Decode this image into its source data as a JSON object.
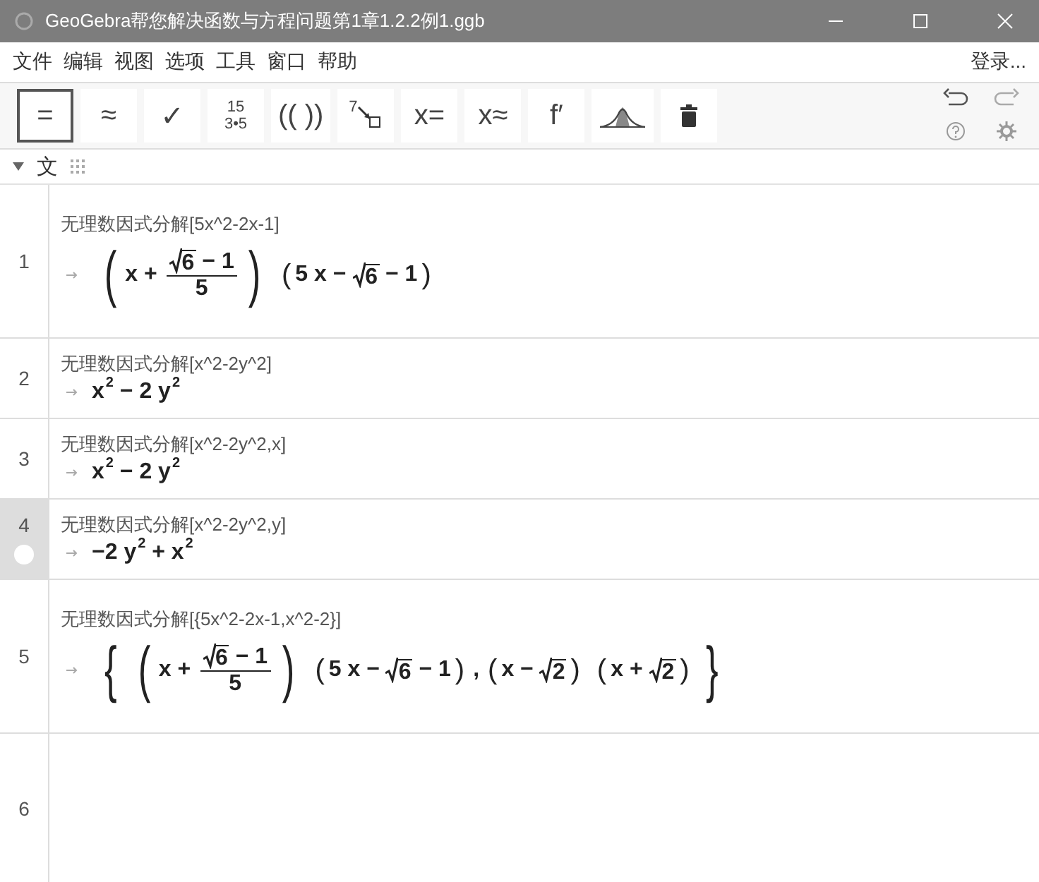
{
  "window": {
    "title": "GeoGebra帮您解决函数与方程问题第1章1.2.2例1.ggb"
  },
  "menu": [
    "文件",
    "编辑",
    "视图",
    "选项",
    "工具",
    "窗口",
    "帮助"
  ],
  "login": "登录...",
  "tools": [
    {
      "kind": "text",
      "label": "=",
      "selected": true
    },
    {
      "kind": "text",
      "label": "≈",
      "selected": false
    },
    {
      "kind": "text",
      "label": "✓",
      "selected": false
    },
    {
      "kind": "frac",
      "num": "15",
      "den": "3•5",
      "selected": false
    },
    {
      "kind": "text",
      "label": "(( ))",
      "selected": false
    },
    {
      "kind": "round",
      "label": "7",
      "selected": false
    },
    {
      "kind": "text",
      "label": "x=",
      "selected": false
    },
    {
      "kind": "text",
      "label": "x≈",
      "selected": false
    },
    {
      "kind": "text",
      "label": "f′",
      "selected": false
    },
    {
      "kind": "curve",
      "selected": false
    },
    {
      "kind": "trash",
      "selected": false
    }
  ],
  "algebra_header": {
    "expanded": true,
    "label": "文"
  },
  "rows": [
    {
      "number": "1",
      "input": "无理数因式分解[5x^2-2x-1]",
      "selected": false,
      "output": [
        {
          "kind": "group",
          "open": "(",
          "close": ")",
          "items": [
            {
              "kind": "t",
              "text": "x + "
            },
            {
              "kind": "frac",
              "num": [
                {
                  "kind": "sqrt",
                  "text": "6"
                },
                {
                  "kind": "t",
                  "text": " − 1"
                }
              ],
              "den": [
                {
                  "kind": "t",
                  "text": "5"
                }
              ]
            }
          ]
        },
        {
          "kind": "group",
          "open": "(",
          "close": ")",
          "items": [
            {
              "kind": "t",
              "text": "5 x − "
            },
            {
              "kind": "sqrt",
              "text": "6"
            },
            {
              "kind": "t",
              "text": " − 1"
            }
          ]
        }
      ]
    },
    {
      "number": "2",
      "input": "无理数因式分解[x^2-2y^2]",
      "selected": false,
      "output": [
        {
          "kind": "t",
          "text": "x"
        },
        {
          "kind": "sup",
          "text": "2"
        },
        {
          "kind": "t",
          "text": " − 2 y"
        },
        {
          "kind": "sup",
          "text": "2"
        }
      ]
    },
    {
      "number": "3",
      "input": "无理数因式分解[x^2-2y^2,x]",
      "selected": false,
      "output": [
        {
          "kind": "t",
          "text": "x"
        },
        {
          "kind": "sup",
          "text": "2"
        },
        {
          "kind": "t",
          "text": " − 2 y"
        },
        {
          "kind": "sup",
          "text": "2"
        }
      ]
    },
    {
      "number": "4",
      "input": "无理数因式分解[x^2-2y^2,y]",
      "selected": true,
      "output": [
        {
          "kind": "t",
          "text": "−2 y"
        },
        {
          "kind": "sup",
          "text": "2"
        },
        {
          "kind": "t",
          "text": " + x"
        },
        {
          "kind": "sup",
          "text": "2"
        }
      ]
    },
    {
      "number": "5",
      "input": "无理数因式分解[{5x^2-2x-1,x^2-2}]",
      "selected": false,
      "output": [
        {
          "kind": "group",
          "open": "{",
          "close": "}",
          "items": [
            {
              "kind": "group",
              "open": "(",
              "close": ")",
              "items": [
                {
                  "kind": "t",
                  "text": "x + "
                },
                {
                  "kind": "frac",
                  "num": [
                    {
                      "kind": "sqrt",
                      "text": "6"
                    },
                    {
                      "kind": "t",
                      "text": " − 1"
                    }
                  ],
                  "den": [
                    {
                      "kind": "t",
                      "text": "5"
                    }
                  ]
                }
              ]
            },
            {
              "kind": "group",
              "open": "(",
              "close": ")",
              "items": [
                {
                  "kind": "t",
                  "text": "5 x − "
                },
                {
                  "kind": "sqrt",
                  "text": "6"
                },
                {
                  "kind": "t",
                  "text": " − 1"
                }
              ]
            },
            {
              "kind": "t",
              "text": ","
            },
            {
              "kind": "group",
              "open": "(",
              "close": ")",
              "items": [
                {
                  "kind": "t",
                  "text": "x − "
                },
                {
                  "kind": "sqrt",
                  "text": "2"
                }
              ]
            },
            {
              "kind": "group",
              "open": "(",
              "close": ")",
              "items": [
                {
                  "kind": "t",
                  "text": "x + "
                },
                {
                  "kind": "sqrt",
                  "text": "2"
                }
              ]
            }
          ]
        }
      ]
    }
  ],
  "empty_row": {
    "number": "6"
  }
}
